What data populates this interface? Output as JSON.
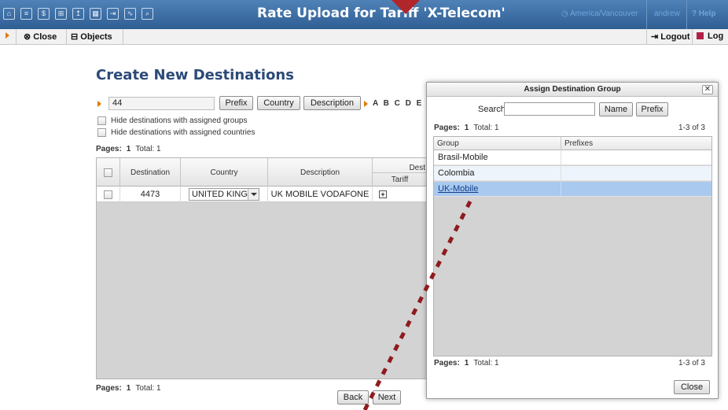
{
  "app": {
    "title": "Rate Upload for Tariff 'X-Telecom'",
    "timezone": "America/Vancouver",
    "user": "andrew",
    "help": "Help",
    "timezone_icon": "clock-icon",
    "help_icon": "question-icon"
  },
  "top_icons": [
    "home-icon",
    "list-icon",
    "dollar-icon",
    "grid-icon",
    "upload-icon",
    "table-icon",
    "export-icon",
    "chart-icon",
    "search-icon"
  ],
  "toolbar": {
    "close_label": "Close",
    "objects_label": "Objects",
    "logout_label": "Logout",
    "log_label": "Log"
  },
  "page": {
    "title": "Create New Destinations",
    "search_value": "44",
    "prefix_btn": "Prefix",
    "country_btn": "Country",
    "description_btn": "Description",
    "letters": "A B C D E F",
    "hide_groups_label": "Hide destinations with assigned groups",
    "hide_countries_label": "Hide destinations with assigned countries",
    "pages_label": "Pages:",
    "pages_value": "1",
    "total_label": "Total: 1",
    "back_btn": "Back",
    "next_btn": "Next"
  },
  "grid": {
    "headers": {
      "destination": "Destination",
      "country": "Country",
      "description": "Description",
      "dest_group": "Dest",
      "tariff": "Tariff"
    },
    "rows": [
      {
        "destination": "4473",
        "country": "UNITED KINGI",
        "description": "UK MOBILE VODAFONE",
        "group_icon": "plus-icon"
      }
    ]
  },
  "dialog": {
    "title": "Assign Destination Group",
    "close_x": "✕",
    "search_label": "Search",
    "search_value": "",
    "name_btn": "Name",
    "prefix_btn": "Prefix",
    "pages_label": "Pages:",
    "pages_value": "1",
    "total_label": "Total: 1",
    "range": "1-3 of 3",
    "col_group": "Group",
    "col_prefixes": "Prefixes",
    "rows": [
      {
        "group": "Brasil-Mobile",
        "prefixes": ""
      },
      {
        "group": "Colombia",
        "prefixes": ""
      },
      {
        "group": "UK-Mobile",
        "prefixes": ""
      }
    ],
    "close_btn": "Close"
  },
  "colors": {
    "topbar": "#3c6ea5",
    "title_blue": "#2b4a78",
    "accent_orange": "#e07a00",
    "selected_row": "#a9c9ee",
    "annotation": "#8e1b1f"
  }
}
